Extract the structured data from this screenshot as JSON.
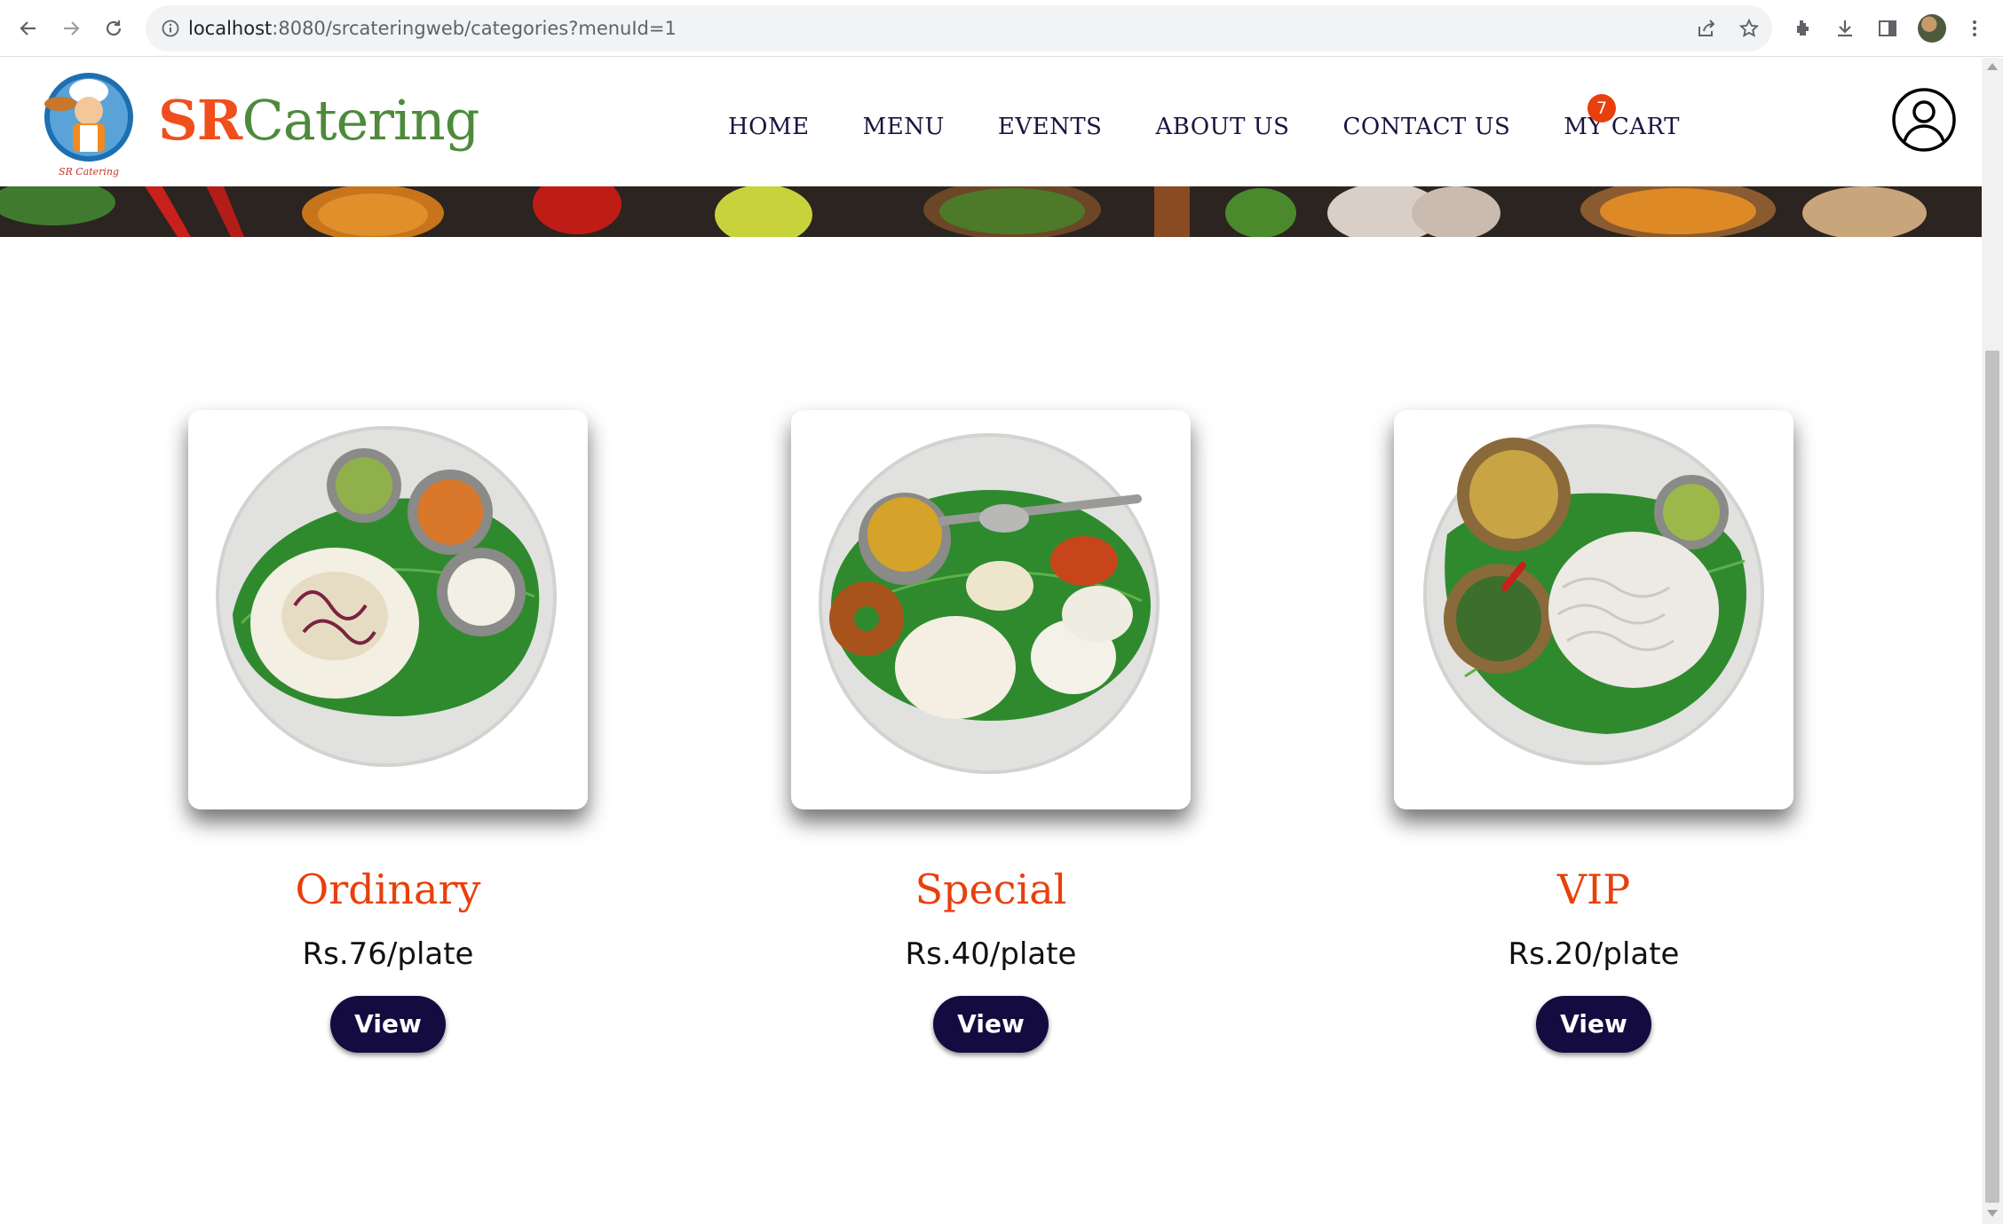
{
  "browser": {
    "url_host": "localhost",
    "url_rest": ":8080/srcateringweb/categories?menuId=1"
  },
  "brand": {
    "part1": "SR",
    "part2": "Catering"
  },
  "nav": [
    "HOME",
    "MENU",
    "EVENTS",
    "ABOUT US",
    "CONTACT US",
    "MY CART"
  ],
  "cart_count": "7",
  "categories": [
    {
      "name": "Ordinary",
      "price": "Rs.76/plate",
      "button": "View"
    },
    {
      "name": "Special",
      "price": "Rs.40/plate",
      "button": "View"
    },
    {
      "name": "VIP",
      "price": "Rs.20/plate",
      "button": "View"
    }
  ],
  "colors": {
    "accent_orange": "#e8400c",
    "brand_green": "#4e8a3c",
    "navy": "#140c40"
  }
}
